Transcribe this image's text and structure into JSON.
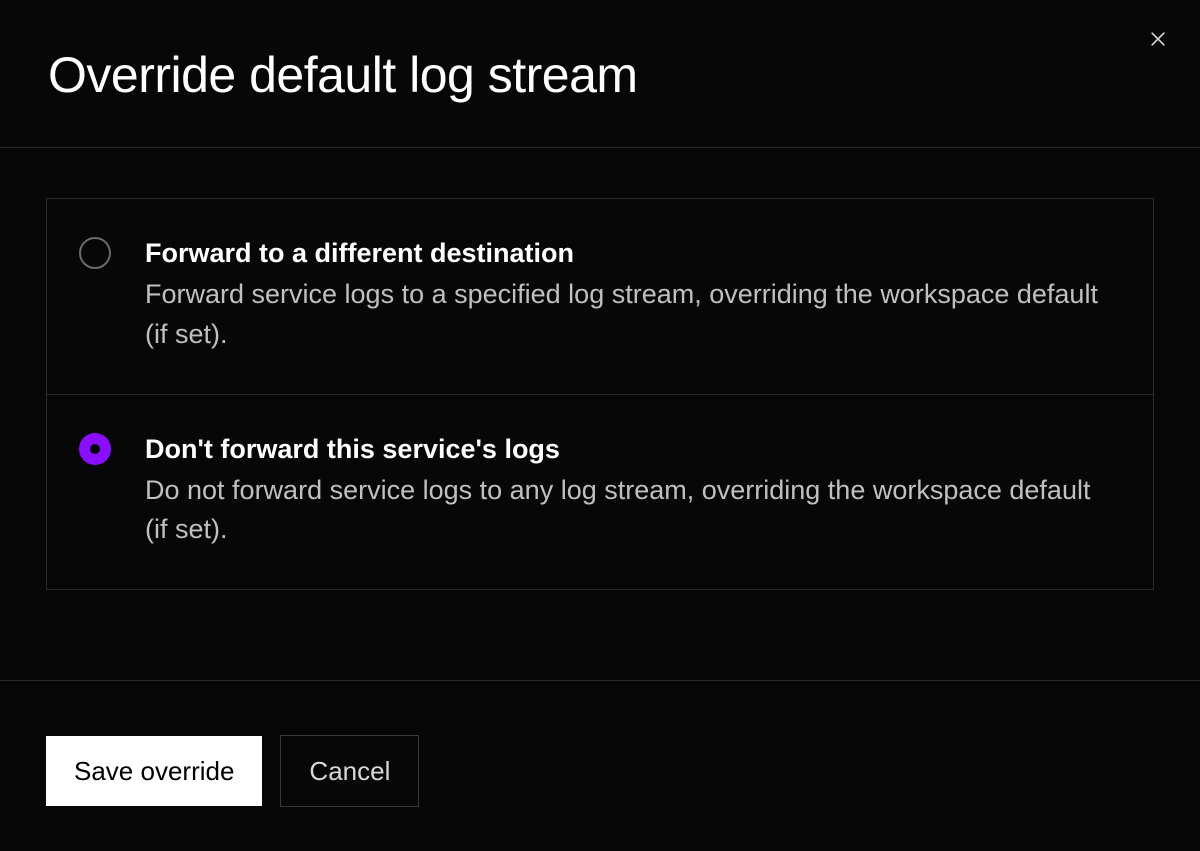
{
  "modal": {
    "title": "Override default log stream",
    "options": [
      {
        "title": "Forward to a different destination",
        "description": "Forward service logs to a specified log stream, overriding the workspace default (if set).",
        "selected": false
      },
      {
        "title": "Don't forward this service's logs",
        "description": "Do not forward service logs to any log stream, overriding the workspace default (if set).",
        "selected": true
      }
    ],
    "actions": {
      "save": "Save override",
      "cancel": "Cancel"
    }
  }
}
